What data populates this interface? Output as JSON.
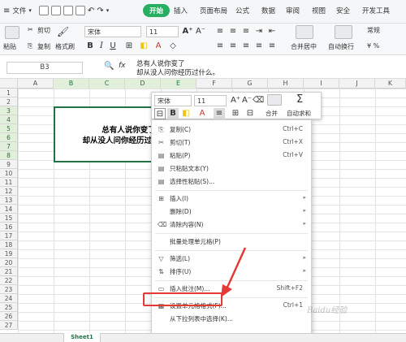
{
  "menubar": {
    "file_label": "文件",
    "tabs": [
      {
        "label": "开始",
        "active": true
      },
      {
        "label": "插入"
      },
      {
        "label": "页面布局"
      },
      {
        "label": "公式"
      },
      {
        "label": "数据"
      },
      {
        "label": "审阅"
      },
      {
        "label": "视图"
      },
      {
        "label": "安全"
      },
      {
        "label": "开发工具"
      }
    ]
  },
  "ribbon": {
    "cut": "剪切",
    "paste": "粘贴",
    "copy": "复制",
    "format_painter": "格式刷",
    "font_name": "宋体",
    "font_size": "11",
    "merge_center": "合并居中",
    "wrap_text": "自动换行",
    "number_format": "常规"
  },
  "formula_bar": {
    "cell_ref": "B3",
    "fx": "fx",
    "line1": "总有人说你变了",
    "line2": "却从没人问你经历过什么。"
  },
  "grid": {
    "columns": [
      "A",
      "B",
      "C",
      "D",
      "E",
      "F",
      "G",
      "H",
      "I",
      "J",
      "K"
    ],
    "rows": [
      "1",
      "2",
      "3",
      "4",
      "5",
      "6",
      "7",
      "8",
      "9",
      "10",
      "11",
      "12",
      "13",
      "14",
      "15",
      "16",
      "17",
      "18",
      "19",
      "20",
      "21",
      "22",
      "23",
      "24",
      "25",
      "26",
      "27"
    ],
    "merged_line1": "总有人说你变了",
    "merged_line2": "却从没人问你经历过什么。"
  },
  "mini_toolbar": {
    "font_name": "宋体",
    "font_size": "11",
    "bold": "B",
    "merge": "合并",
    "autosum": "自动求和"
  },
  "context_menu": {
    "items": [
      {
        "label": "复制(C)",
        "shortcut": "Ctrl+C",
        "icon": "copy-icon"
      },
      {
        "label": "剪切(T)",
        "shortcut": "Ctrl+X",
        "icon": "scissors-icon"
      },
      {
        "label": "粘贴(P)",
        "shortcut": "Ctrl+V",
        "icon": "paste-icon"
      },
      {
        "label": "只粘贴文本(Y)",
        "shortcut": "",
        "icon": "paste-text-icon"
      },
      {
        "label": "选择性粘贴(S)...",
        "shortcut": "",
        "icon": "paste-special-icon"
      },
      {
        "label": "插入(I)",
        "shortcut": "",
        "icon": "insert-icon"
      },
      {
        "label": "删除(D)",
        "shortcut": "",
        "icon": ""
      },
      {
        "label": "清除内容(N)",
        "shortcut": "",
        "icon": "eraser-icon"
      },
      {
        "label": "批量处理单元格(P)",
        "shortcut": "",
        "icon": ""
      },
      {
        "label": "筛选(L)",
        "shortcut": "",
        "icon": "filter-icon"
      },
      {
        "label": "排序(U)",
        "shortcut": "",
        "icon": "sort-icon"
      },
      {
        "label": "插入批注(M)...",
        "shortcut": "Shift+F2",
        "icon": "comment-icon"
      },
      {
        "label": "设置单元格格式(F)...",
        "shortcut": "Ctrl+1",
        "icon": "format-cells-icon"
      },
      {
        "label": "从下拉列表中选择(K)...",
        "shortcut": "",
        "icon": ""
      }
    ]
  },
  "sheet_tab": "Sheet1",
  "watermark": "Baidu经验",
  "colors": {
    "accent": "#27ae60",
    "selection": "#217346",
    "highlight": "#e53935"
  }
}
